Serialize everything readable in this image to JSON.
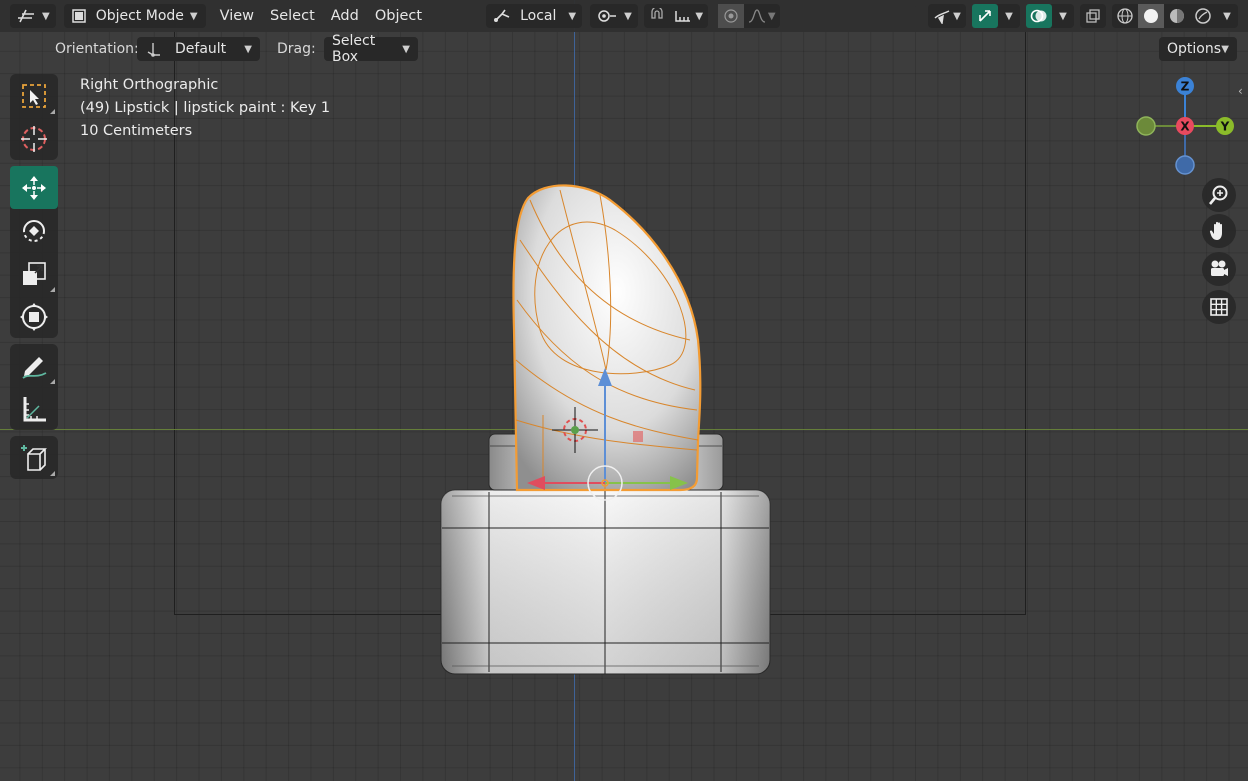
{
  "header": {
    "mode_label": "Object Mode",
    "menus": [
      "View",
      "Select",
      "Add",
      "Object"
    ],
    "transform_orientation": "Local",
    "options_label": "Options"
  },
  "subbar": {
    "orientation_label": "Orientation:",
    "orientation_value": "Default",
    "drag_label": "Drag:",
    "drag_value": "Select Box"
  },
  "viewport_info": {
    "view_name": "Right Orthographic",
    "object_info": "(49) Lipstick | lipstick paint : Key 1",
    "scale": "10 Centimeters"
  },
  "gizmo": {
    "z_label": "Z",
    "x_label": "X",
    "y_label": "Y",
    "colors": {
      "x": "#e84a5f",
      "y": "#8bbb2a",
      "z": "#3b82d6",
      "neg_y": "#6c8a3a",
      "neg_z": "#3f6aa8"
    }
  },
  "tools": [
    "select-box-tool",
    "cursor-tool",
    "move-tool",
    "rotate-tool",
    "scale-tool",
    "transform-tool",
    "annotate-tool",
    "measure-tool",
    "add-cube-tool"
  ],
  "colors": {
    "accent": "#18755e",
    "selection_outline": "#f39c34"
  }
}
